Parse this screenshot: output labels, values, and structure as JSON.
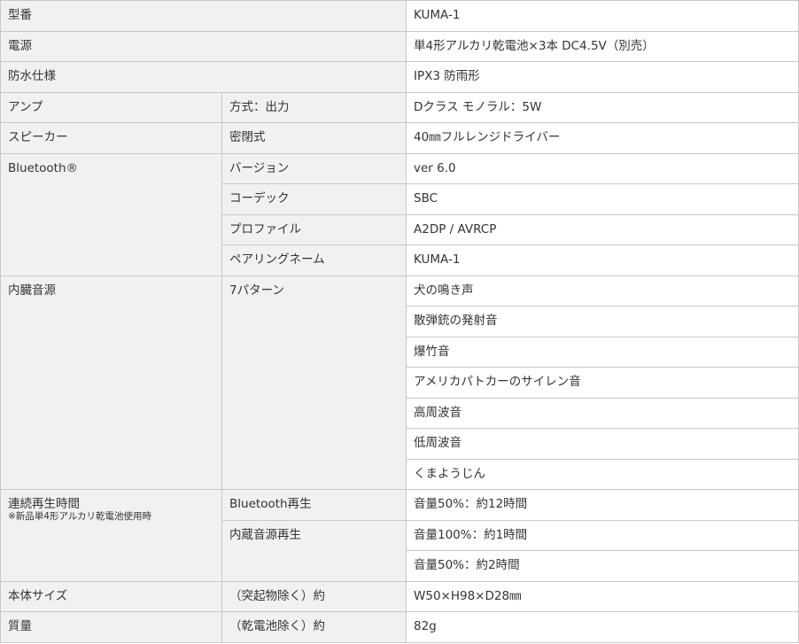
{
  "spec": {
    "model": {
      "label": "型番",
      "value": "KUMA-1"
    },
    "power": {
      "label": "電源",
      "value": "単4形アルカリ乾電池×3本 DC4.5V（別売）"
    },
    "waterproof": {
      "label": "防水仕様",
      "value": "IPX3 防雨形"
    },
    "amp": {
      "label": "アンプ",
      "sub": "方式：出力",
      "value": "Dクラス モノラル：5W"
    },
    "speaker": {
      "label": "スピーカー",
      "sub": "密閉式",
      "value": "40㎜フルレンジドライバー"
    },
    "bluetooth": {
      "label": "Bluetooth®",
      "rows": [
        {
          "sub": "バージョン",
          "value": "ver 6.0"
        },
        {
          "sub": "コーデック",
          "value": "SBC"
        },
        {
          "sub": "プロファイル",
          "value": "A2DP / AVRCP"
        },
        {
          "sub": "ペアリングネーム",
          "value": "KUMA-1"
        }
      ]
    },
    "builtin_sound": {
      "label": "内臓音源",
      "sub": "7パターン",
      "values": [
        "犬の鳴き声",
        "散弾銃の発射音",
        "爆竹音",
        "アメリカパトカーのサイレン音",
        "高周波音",
        "低周波音",
        "くまようじん"
      ]
    },
    "playtime": {
      "label": "連続再生時間",
      "note": "※新品単4形アルカリ乾電池使用時",
      "bt_sub": "Bluetooth再生",
      "bt_value": "音量50%：約12時間",
      "internal_sub": "内蔵音源再生",
      "internal_values": [
        "音量100%：約1時間",
        "音量50%：約2時間"
      ]
    },
    "size": {
      "label": "本体サイズ",
      "sub": "（突起物除く）約",
      "value": "W50×H98×D28㎜"
    },
    "weight": {
      "label": "質量",
      "sub": "（乾電池除く）約",
      "value": "82g"
    }
  }
}
